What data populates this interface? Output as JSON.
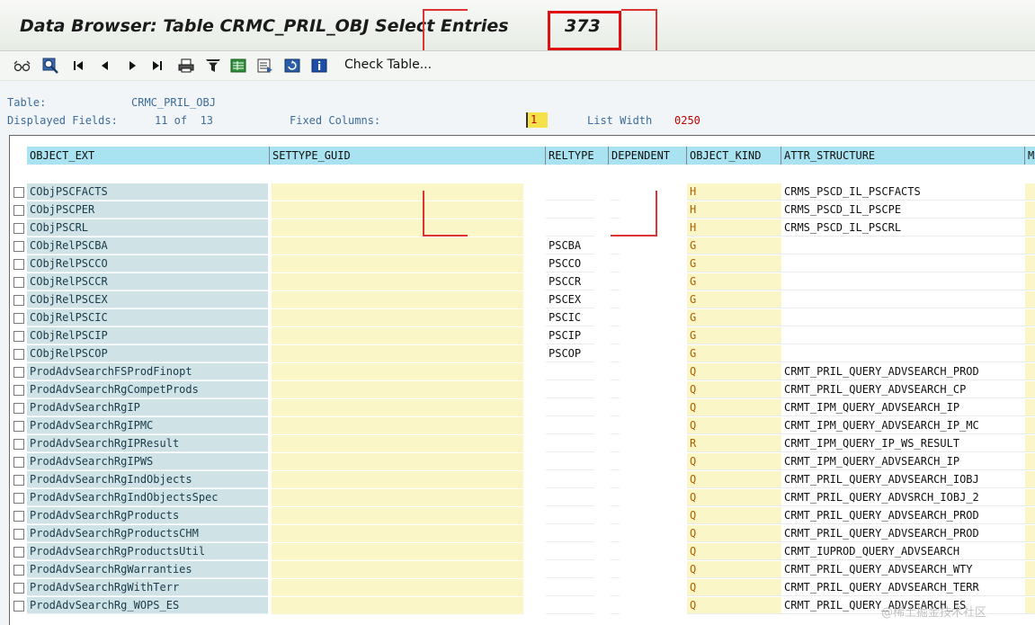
{
  "header": {
    "title": "Data Browser: Table CRMC_PRIL_OBJ Select Entries",
    "count": "373"
  },
  "toolbar": {
    "check_table_label": "Check Table..."
  },
  "info": {
    "table_label": "Table:",
    "table_value": "CRMC_PRIL_OBJ",
    "displayed_fields_label": "Displayed Fields:",
    "displayed_fields_value": "11 of  13",
    "fixed_columns_label": "Fixed Columns:",
    "fixed_columns_value": "1",
    "list_width_label": "List Width",
    "list_width_value": "0250"
  },
  "columns": [
    "OBJECT_EXT",
    "SETTYPE_GUID",
    "RELTYPE",
    "DEPENDENT",
    "OBJECT_KIND",
    "ATTR_STRUCTURE",
    "M"
  ],
  "rows": [
    {
      "object_ext": "CObjPSCFACTS",
      "reltype": "",
      "object_kind": "H",
      "attr_structure": "CRMS_PSCD_IL_PSCFACTS"
    },
    {
      "object_ext": "CObjPSCPER",
      "reltype": "",
      "object_kind": "H",
      "attr_structure": "CRMS_PSCD_IL_PSCPE"
    },
    {
      "object_ext": "CObjPSCRL",
      "reltype": "",
      "object_kind": "H",
      "attr_structure": "CRMS_PSCD_IL_PSCRL"
    },
    {
      "object_ext": "CObjRelPSCBA",
      "reltype": "PSCBA",
      "object_kind": "G",
      "attr_structure": ""
    },
    {
      "object_ext": "CObjRelPSCCO",
      "reltype": "PSCCO",
      "object_kind": "G",
      "attr_structure": ""
    },
    {
      "object_ext": "CObjRelPSCCR",
      "reltype": "PSCCR",
      "object_kind": "G",
      "attr_structure": ""
    },
    {
      "object_ext": "CObjRelPSCEX",
      "reltype": "PSCEX",
      "object_kind": "G",
      "attr_structure": ""
    },
    {
      "object_ext": "CObjRelPSCIC",
      "reltype": "PSCIC",
      "object_kind": "G",
      "attr_structure": ""
    },
    {
      "object_ext": "CObjRelPSCIP",
      "reltype": "PSCIP",
      "object_kind": "G",
      "attr_structure": ""
    },
    {
      "object_ext": "CObjRelPSCOP",
      "reltype": "PSCOP",
      "object_kind": "G",
      "attr_structure": ""
    },
    {
      "object_ext": "ProdAdvSearchFSProdFinopt",
      "reltype": "",
      "object_kind": "Q",
      "attr_structure": "CRMT_PRIL_QUERY_ADVSEARCH_PROD"
    },
    {
      "object_ext": "ProdAdvSearchRgCompetProds",
      "reltype": "",
      "object_kind": "Q",
      "attr_structure": "CRMT_PRIL_QUERY_ADVSEARCH_CP"
    },
    {
      "object_ext": "ProdAdvSearchRgIP",
      "reltype": "",
      "object_kind": "Q",
      "attr_structure": "CRMT_IPM_QUERY_ADVSEARCH_IP"
    },
    {
      "object_ext": "ProdAdvSearchRgIPMC",
      "reltype": "",
      "object_kind": "Q",
      "attr_structure": "CRMT_IPM_QUERY_ADVSEARCH_IP_MC"
    },
    {
      "object_ext": "ProdAdvSearchRgIPResult",
      "reltype": "",
      "object_kind": "R",
      "attr_structure": "CRMT_IPM_QUERY_IP_WS_RESULT"
    },
    {
      "object_ext": "ProdAdvSearchRgIPWS",
      "reltype": "",
      "object_kind": "Q",
      "attr_structure": "CRMT_IPM_QUERY_ADVSEARCH_IP"
    },
    {
      "object_ext": "ProdAdvSearchRgIndObjects",
      "reltype": "",
      "object_kind": "Q",
      "attr_structure": "CRMT_PRIL_QUERY_ADVSEARCH_IOBJ"
    },
    {
      "object_ext": "ProdAdvSearchRgIndObjectsSpec",
      "reltype": "",
      "object_kind": "Q",
      "attr_structure": "CRMT_PRIL_QUERY_ADVSRCH_IOBJ_2"
    },
    {
      "object_ext": "ProdAdvSearchRgProducts",
      "reltype": "",
      "object_kind": "Q",
      "attr_structure": "CRMT_PRIL_QUERY_ADVSEARCH_PROD"
    },
    {
      "object_ext": "ProdAdvSearchRgProductsCHM",
      "reltype": "",
      "object_kind": "Q",
      "attr_structure": "CRMT_PRIL_QUERY_ADVSEARCH_PROD"
    },
    {
      "object_ext": "ProdAdvSearchRgProductsUtil",
      "reltype": "",
      "object_kind": "Q",
      "attr_structure": "CRMT_IUPROD_QUERY_ADVSEARCH"
    },
    {
      "object_ext": "ProdAdvSearchRgWarranties",
      "reltype": "",
      "object_kind": "Q",
      "attr_structure": "CRMT_PRIL_QUERY_ADVSEARCH_WTY"
    },
    {
      "object_ext": "ProdAdvSearchRgWithTerr",
      "reltype": "",
      "object_kind": "Q",
      "attr_structure": "CRMT_PRIL_QUERY_ADVSEARCH_TERR"
    },
    {
      "object_ext": "ProdAdvSearchRg_WOPS_ES",
      "reltype": "",
      "object_kind": "Q",
      "attr_structure": "CRMT_PRIL_QUERY_ADVSEARCH_ES"
    }
  ],
  "watermark": "@稀土掘金技术社区"
}
